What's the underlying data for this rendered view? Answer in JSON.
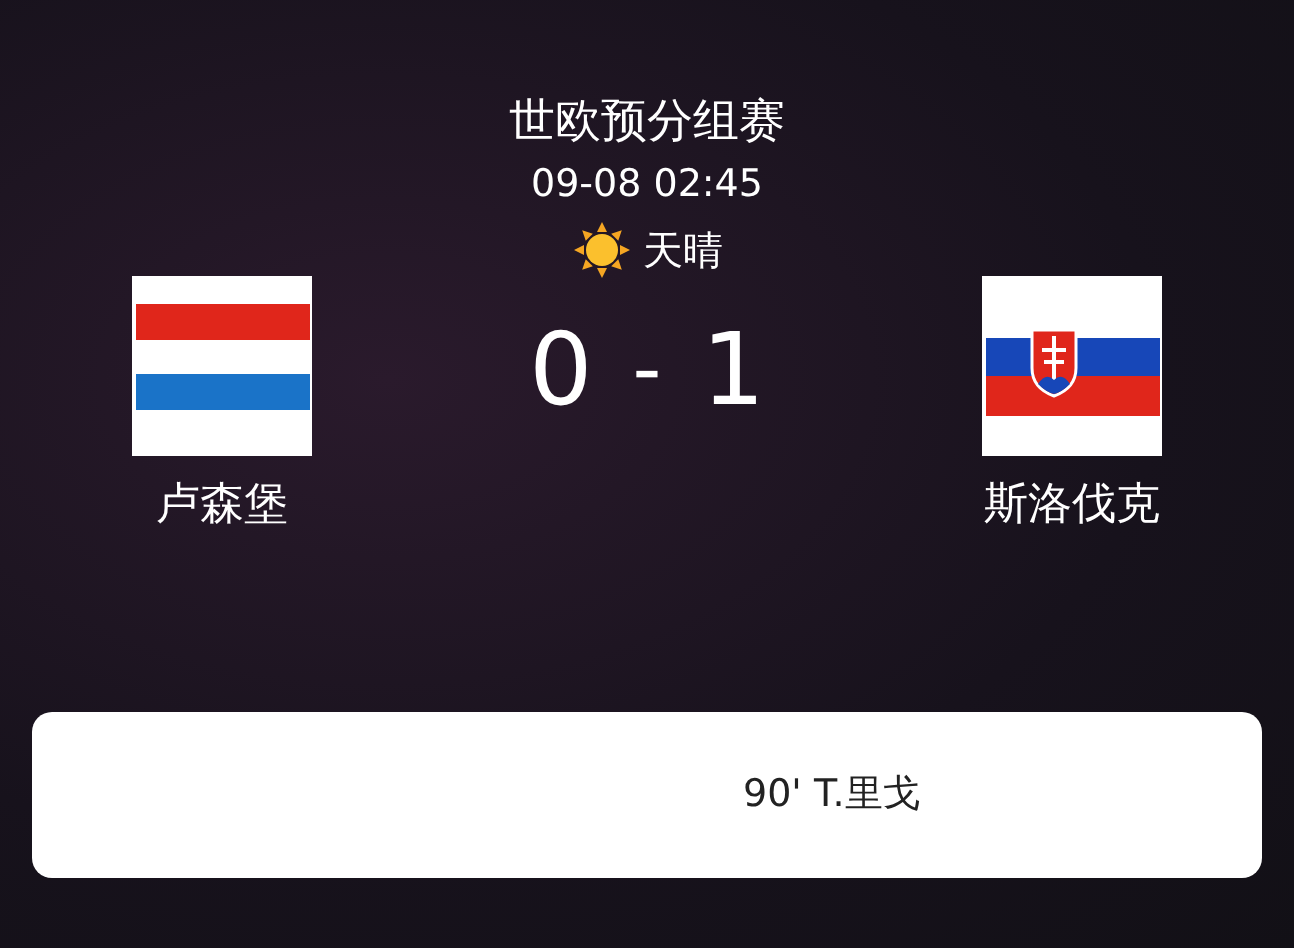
{
  "match": {
    "competition": "世欧预分组赛",
    "datetime": "09-08 02:45",
    "weather": "天晴"
  },
  "home": {
    "name": "卢森堡",
    "score": "0"
  },
  "separator": "-",
  "away": {
    "name": "斯洛伐克",
    "score": "1"
  },
  "events": [
    {
      "kind": "away",
      "text": "90' T.里戈"
    }
  ]
}
